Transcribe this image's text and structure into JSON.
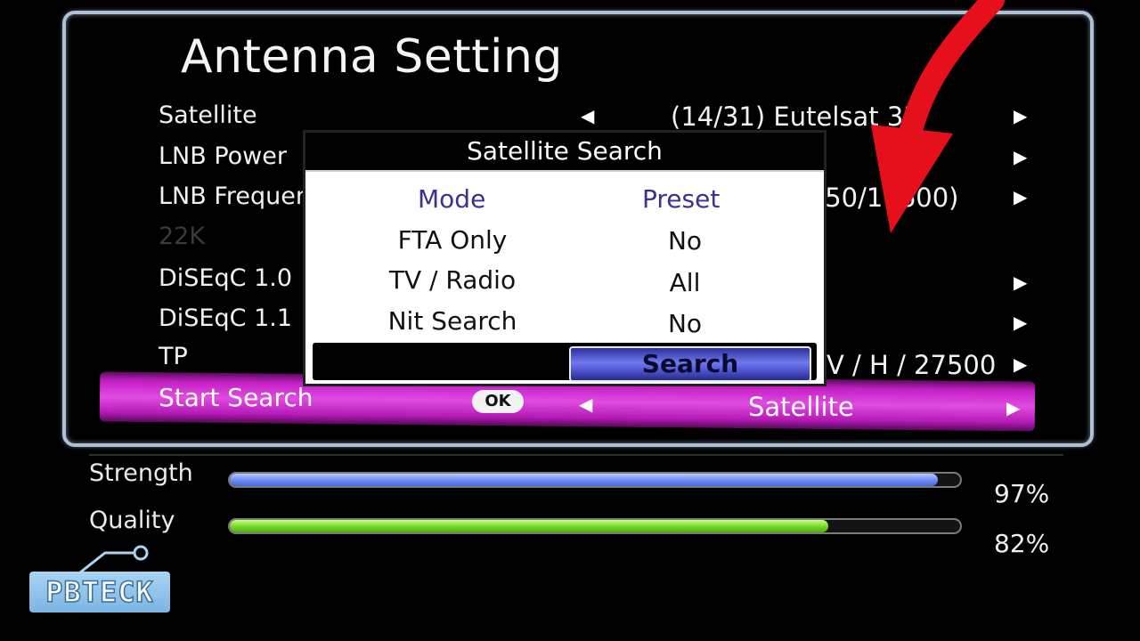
{
  "title": "Antenna Setting",
  "rows": [
    {
      "label": "Satellite",
      "value": "(14/31) Eutelsat 3B"
    },
    {
      "label": "LNB Power",
      "value": ""
    },
    {
      "label": "LNB Frequency",
      "value": "(9750/10600)"
    },
    {
      "label": "22K",
      "value": ""
    },
    {
      "label": "DiSEqC 1.0",
      "value": ""
    },
    {
      "label": "DiSEqC 1.1",
      "value": ""
    },
    {
      "label": "TP",
      "value": "V / H / 27500"
    }
  ],
  "start_search": {
    "label": "Start Search",
    "ok": "OK",
    "value": "Satellite"
  },
  "popup": {
    "title": "Satellite Search",
    "col_mode": "Mode",
    "col_preset": "Preset",
    "items": [
      {
        "mode": "FTA Only",
        "preset": "No"
      },
      {
        "mode": "TV / Radio",
        "preset": "All"
      },
      {
        "mode": "Nit Search",
        "preset": "No"
      }
    ],
    "search_button": "Search"
  },
  "signal": {
    "strength_label": "Strength",
    "strength_value": 97,
    "strength_text": "97%",
    "quality_label": "Quality",
    "quality_value": 82,
    "quality_text": "82%"
  },
  "logo": "PBTECK",
  "colors": {
    "highlight": "#d23ad3",
    "strength": "#6f8ff0",
    "quality": "#7bd92c",
    "annotation": "#e5101c"
  }
}
